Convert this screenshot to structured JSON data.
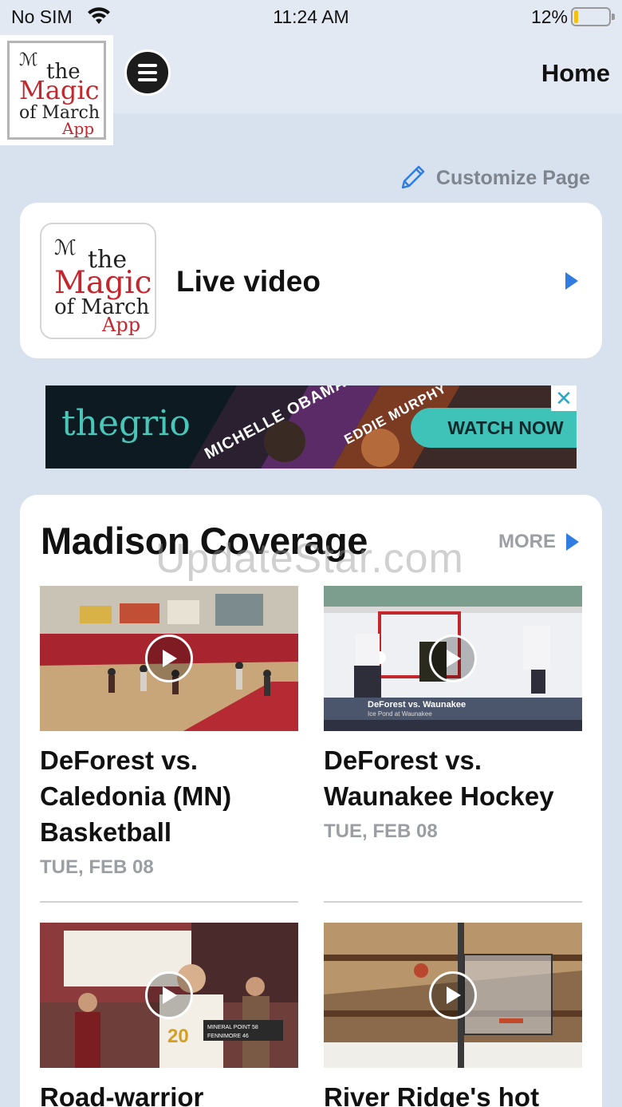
{
  "status_bar": {
    "carrier": "No SIM",
    "time": "11:24 AM",
    "battery_percent": "12%",
    "battery_level": 0.12
  },
  "header": {
    "logo": {
      "line1": "the",
      "line2": "Magic",
      "line3": "of March",
      "line4": "App"
    },
    "title": "Home"
  },
  "customize": {
    "label": "Customize Page"
  },
  "live_card": {
    "title": "Live video"
  },
  "ad": {
    "brand": "thegrio",
    "name1": "MICHELLE OBAMA",
    "name2": "EDDIE MURPHY",
    "cta": "WATCH NOW",
    "close": "✕"
  },
  "coverage": {
    "title": "Madison Coverage",
    "more_label": "MORE",
    "items": [
      {
        "title": "DeForest vs. Caledonia (MN) Basketball",
        "date": "TUE, FEB 08",
        "scene": "basketball"
      },
      {
        "title": "DeForest vs. Waunakee Hockey",
        "date": "TUE, FEB 08",
        "scene": "hockey",
        "lower_third_1": "DeForest vs. Waunakee",
        "lower_third_2": "Ice Pond at Waunakee"
      },
      {
        "title": "Road-warrior Mineral",
        "date": "",
        "scene": "bench",
        "score_1": "MINERAL POINT 58",
        "score_2": "FENNIMORE 46"
      },
      {
        "title": "River Ridge's hot",
        "date": "",
        "scene": "gym"
      }
    ]
  },
  "watermark": "UpdateStar.com",
  "colors": {
    "accent": "#2f7de1",
    "logo_red": "#c4262e",
    "card": "#ffffff",
    "background": "#d8e2ef"
  }
}
